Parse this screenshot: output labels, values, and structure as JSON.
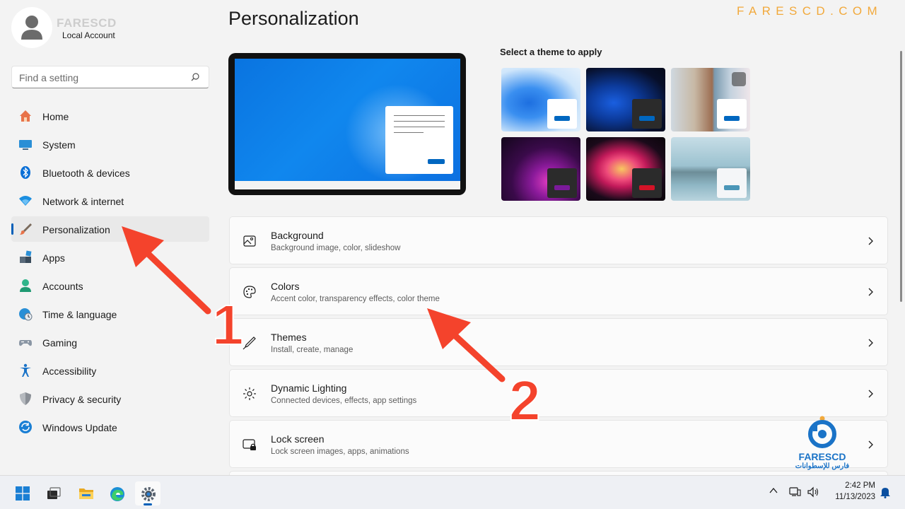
{
  "profile": {
    "name": "FARESCD",
    "account_type": "Local Account"
  },
  "search": {
    "placeholder": "Find a setting",
    "value": ""
  },
  "sidebar": {
    "items": [
      {
        "label": "Home",
        "icon": "home-icon",
        "active": false
      },
      {
        "label": "System",
        "icon": "system-icon",
        "active": false
      },
      {
        "label": "Bluetooth & devices",
        "icon": "bluetooth-icon",
        "active": false
      },
      {
        "label": "Network & internet",
        "icon": "wifi-icon",
        "active": false
      },
      {
        "label": "Personalization",
        "icon": "brush-icon",
        "active": true
      },
      {
        "label": "Apps",
        "icon": "apps-icon",
        "active": false
      },
      {
        "label": "Accounts",
        "icon": "accounts-icon",
        "active": false
      },
      {
        "label": "Time & language",
        "icon": "globe-clock-icon",
        "active": false
      },
      {
        "label": "Gaming",
        "icon": "gamepad-icon",
        "active": false
      },
      {
        "label": "Accessibility",
        "icon": "accessibility-icon",
        "active": false
      },
      {
        "label": "Privacy & security",
        "icon": "shield-icon",
        "active": false
      },
      {
        "label": "Windows Update",
        "icon": "update-icon",
        "active": false
      }
    ]
  },
  "main": {
    "title": "Personalization",
    "brand": "FARESCD.COM",
    "theme_heading": "Select a theme to apply",
    "themes": [
      {
        "name": "windows-light",
        "accent": "#0067c0"
      },
      {
        "name": "windows-dark",
        "accent": "#0067c0"
      },
      {
        "name": "spotlight",
        "accent": "#0067c0"
      },
      {
        "name": "glow",
        "accent": "#7b1a9a"
      },
      {
        "name": "captured-motion",
        "accent": "#d41327"
      },
      {
        "name": "flow",
        "accent": "#4a96b8"
      }
    ],
    "cards": [
      {
        "title": "Background",
        "subtitle": "Background image, color, slideshow",
        "icon": "image-icon"
      },
      {
        "title": "Colors",
        "subtitle": "Accent color, transparency effects, color theme",
        "icon": "palette-icon"
      },
      {
        "title": "Themes",
        "subtitle": "Install, create, manage",
        "icon": "pen-icon"
      },
      {
        "title": "Dynamic Lighting",
        "subtitle": "Connected devices, effects, app settings",
        "icon": "lighting-icon"
      },
      {
        "title": "Lock screen",
        "subtitle": "Lock screen images, apps, animations",
        "icon": "lock-screen-icon"
      }
    ]
  },
  "watermark": {
    "name": "FARESCD",
    "arabic": "فارس للإسطوانات"
  },
  "annotations": {
    "step1": "1",
    "step2": "2"
  },
  "taskbar": {
    "apps": [
      "start-icon",
      "task-view-icon",
      "file-explorer-icon",
      "edge-icon",
      "settings-icon"
    ],
    "time": "2:42 PM",
    "date": "11/13/2023"
  },
  "colors": {
    "accent": "#005fb8",
    "annotation": "#f4432c",
    "brand": "#f2a93b"
  }
}
